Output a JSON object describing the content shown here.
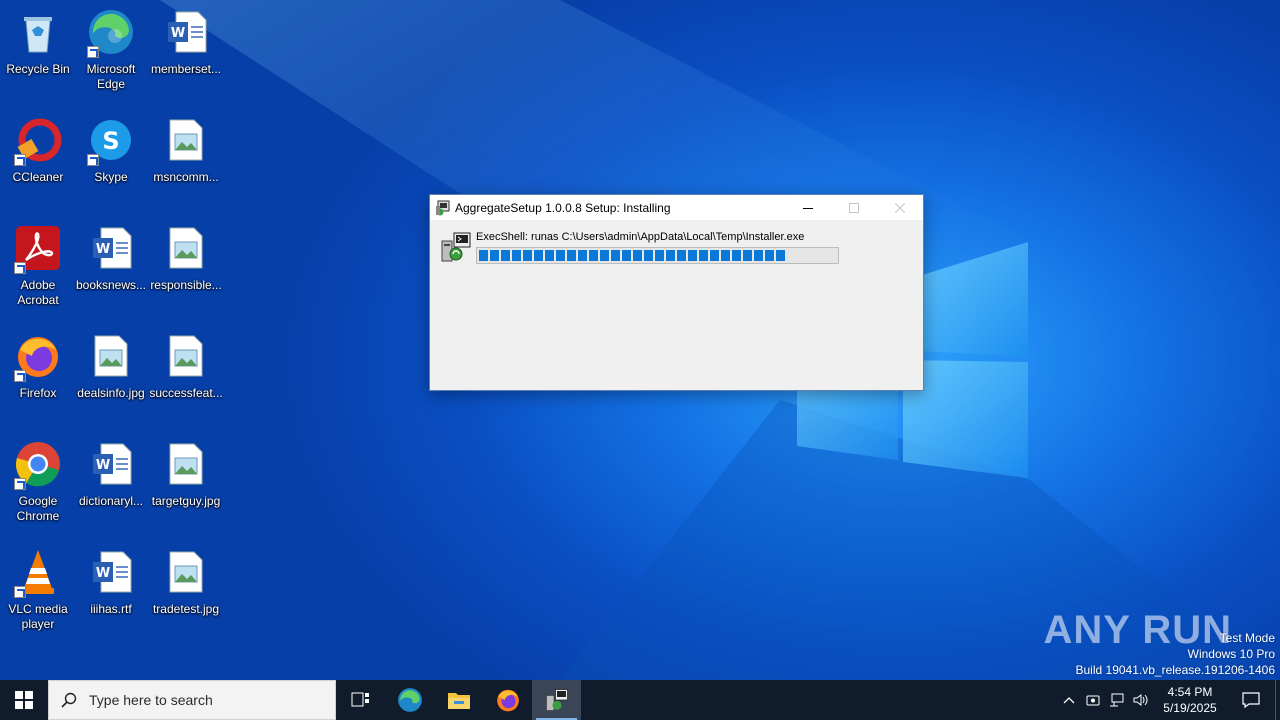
{
  "desktop": {
    "icons": [
      {
        "label": "Recycle Bin",
        "icon": "recycle-bin-icon"
      },
      {
        "label": "Microsoft Edge",
        "icon": "edge-icon"
      },
      {
        "label": "memberset...",
        "icon": "word-document-icon"
      },
      {
        "label": "CCleaner",
        "icon": "ccleaner-icon"
      },
      {
        "label": "Skype",
        "icon": "skype-icon"
      },
      {
        "label": "msncomm...",
        "icon": "image-file-icon"
      },
      {
        "label": "Adobe Acrobat",
        "icon": "acrobat-icon"
      },
      {
        "label": "booksnews...",
        "icon": "word-document-icon"
      },
      {
        "label": "responsible...",
        "icon": "image-file-icon"
      },
      {
        "label": "Firefox",
        "icon": "firefox-icon"
      },
      {
        "label": "dealsinfo.jpg",
        "icon": "image-file-icon"
      },
      {
        "label": "successfeat...",
        "icon": "image-file-icon"
      },
      {
        "label": "Google Chrome",
        "icon": "chrome-icon"
      },
      {
        "label": "dictionaryl...",
        "icon": "word-document-icon"
      },
      {
        "label": "targetguy.jpg",
        "icon": "image-file-icon"
      },
      {
        "label": "VLC media player",
        "icon": "vlc-icon"
      },
      {
        "label": "iiihas.rtf",
        "icon": "word-document-icon"
      },
      {
        "label": "tradetest.jpg",
        "icon": "image-file-icon"
      }
    ]
  },
  "installer": {
    "title": "AggregateSetup 1.0.0.8 Setup: Installing",
    "status_text": "ExecShell: runas C:\\Users\\admin\\AppData\\Local\\Temp\\Installer.exe",
    "progress_fraction": 0.86,
    "controls": {
      "minimize": "—",
      "maximize": "☐",
      "close": "✕"
    }
  },
  "watermark": {
    "brand": "ANY RUN",
    "mode": "Test Mode",
    "edition": "Windows 10 Pro",
    "build": "Build 19041.vb_release.191206-1406"
  },
  "taskbar": {
    "search_placeholder": "Type here to search",
    "apps": [
      "task-view-icon",
      "edge-icon",
      "file-explorer-icon",
      "firefox-icon",
      "installer-icon"
    ],
    "clock_time": "4:54 PM",
    "clock_date": "5/19/2025"
  },
  "colors": {
    "wallpaper": "#0a57c8",
    "taskbar": "#101c2c",
    "progress": "#0a78d7"
  }
}
